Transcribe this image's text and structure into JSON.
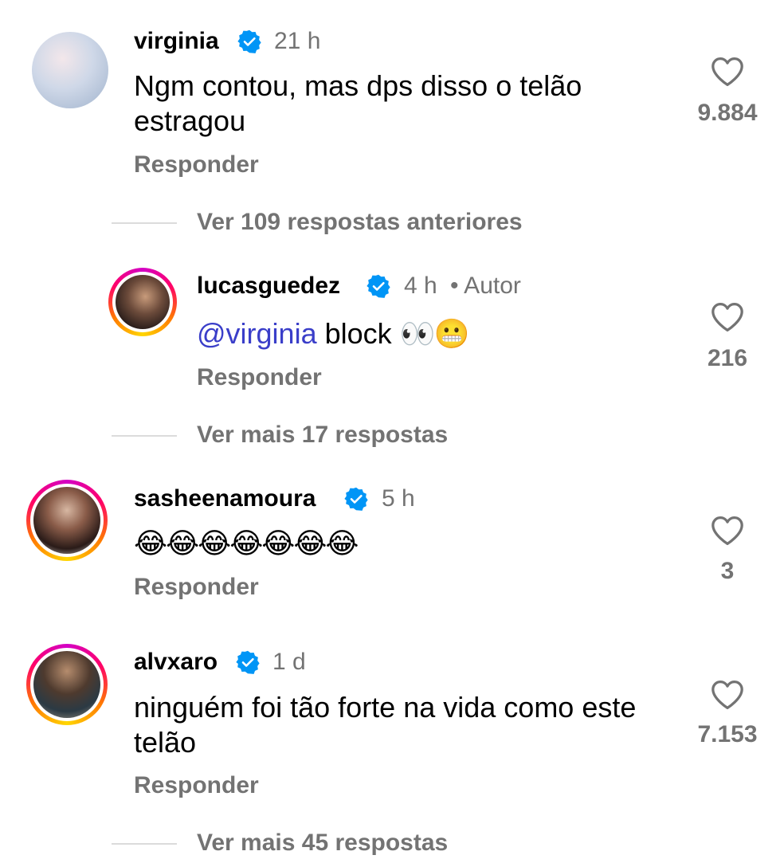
{
  "comments": [
    {
      "username": "virginia",
      "time": "21 h",
      "text": "Ngm contou, mas dps disso o telão estragou",
      "reply_label": "Responder",
      "likes": "9.884",
      "verified": true
    },
    {
      "username": "lucasguedez",
      "time": "4 h",
      "author_badge": "• Autor",
      "mention": "@virginia",
      "text": "block",
      "emojis": "👀😬",
      "reply_label": "Responder",
      "likes": "216",
      "verified": true
    },
    {
      "username": "sasheenamoura",
      "time": "5 h",
      "emojis": "😂😂😂😂😂😂😂",
      "reply_label": "Responder",
      "likes": "3",
      "verified": true
    },
    {
      "username": "alvxaro",
      "time": "1 d",
      "text": "ninguém foi tão forte na vida como este telão",
      "reply_label": "Responder",
      "likes": "7.153",
      "verified": true
    }
  ],
  "threads": {
    "previous_replies": "Ver 109 respostas anteriores",
    "more_replies_1": "Ver mais 17 respostas",
    "more_replies_2": "Ver mais 45 respostas"
  },
  "colors": {
    "verified_blue": "#0095f6",
    "muted_text": "#737373",
    "mention": "#3a3ec9"
  }
}
